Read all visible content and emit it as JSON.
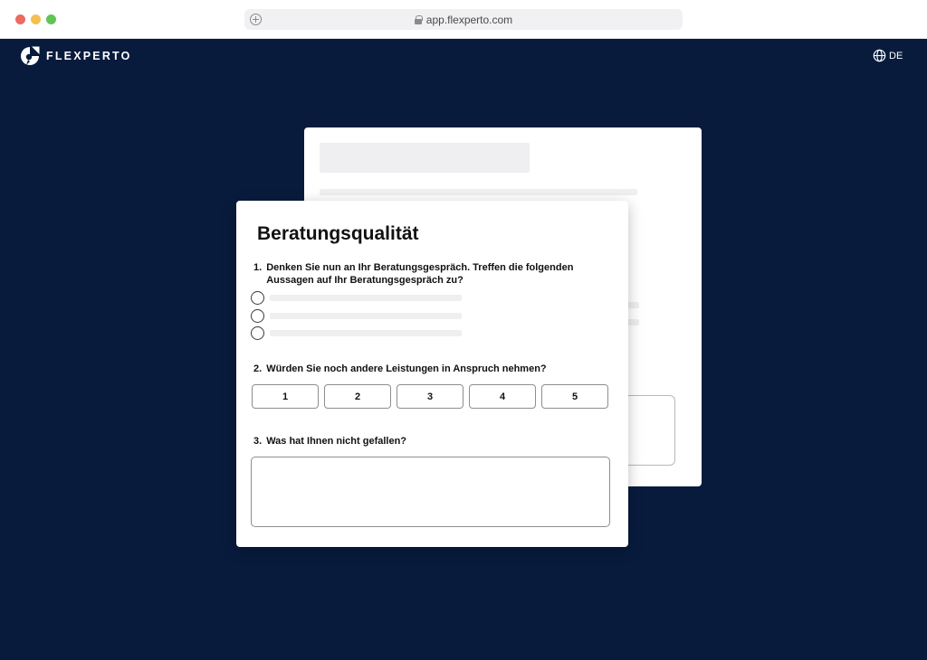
{
  "browser": {
    "url": "app.flexperto.com"
  },
  "header": {
    "brand": "FLEXPERTO",
    "language": "DE"
  },
  "survey": {
    "title": "Beratungsqualität",
    "questions": [
      {
        "number": "1.",
        "text": "Denken Sie nun an Ihr Beratungsgespräch. Treffen die folgenden Aussagen auf Ihr Beratungsgespräch zu?"
      },
      {
        "number": "2.",
        "text": "Würden Sie noch andere Leistungen in Anspruch nehmen?"
      },
      {
        "number": "3.",
        "text": "Was hat Ihnen nicht gefallen?"
      }
    ],
    "rating_options": [
      "1",
      "2",
      "3",
      "4",
      "5"
    ]
  },
  "colors": {
    "app_background": "#081b3d",
    "card": "#ffffff",
    "skeleton": "#efeff1"
  },
  "icons": [
    "add-tab-icon",
    "lock-icon",
    "flexperto-logo-icon",
    "globe-icon"
  ]
}
